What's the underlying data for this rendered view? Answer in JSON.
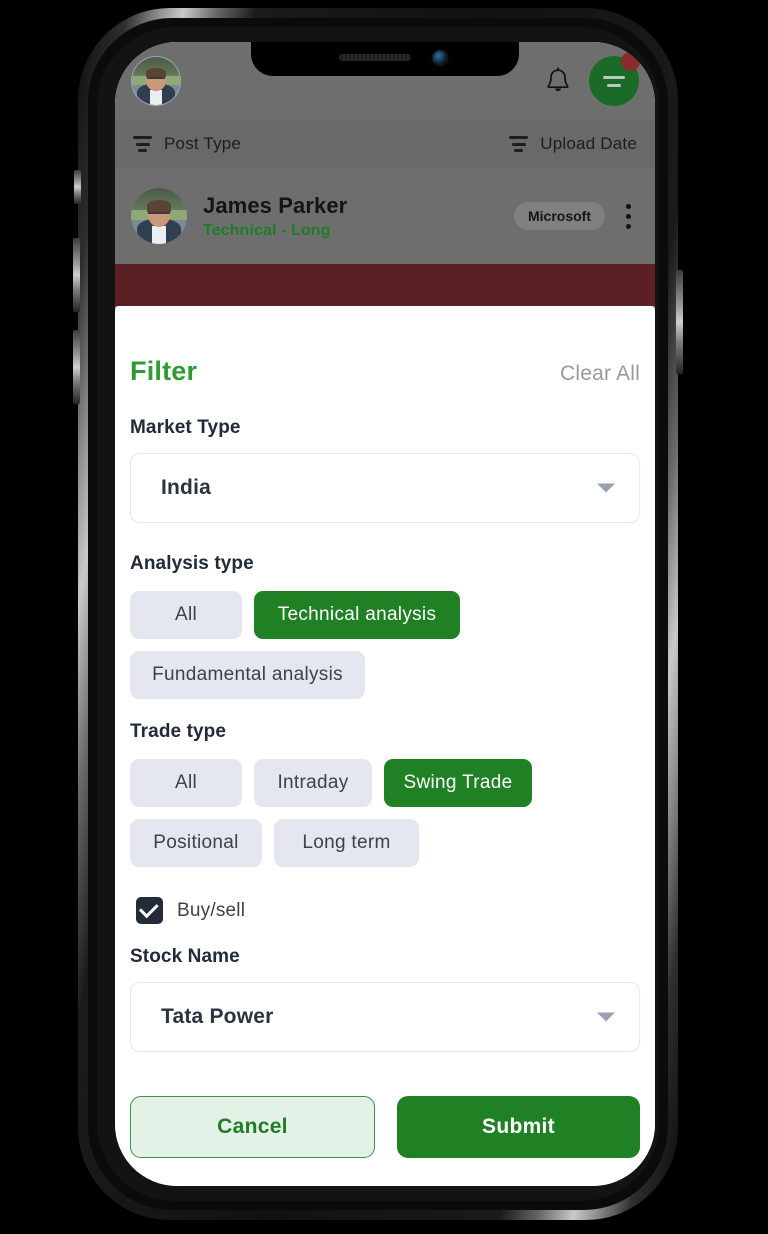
{
  "app": {
    "header": {
      "profile_avatar": "user-avatar",
      "bell_icon": "bell-icon",
      "menu_icon": "hamburger-menu-icon",
      "notification_badge": ""
    },
    "sort_bar": {
      "post_type_label": "Post Type",
      "upload_date_label": "Upload Date",
      "filter_icon": "filter-lines-icon"
    },
    "post": {
      "author": "James Parker",
      "subtitle": "Technical - Long",
      "tag": "Microsoft",
      "more_icon": "more-vertical-icon"
    }
  },
  "filter_sheet": {
    "title": "Filter",
    "clear_all": "Clear All",
    "market_type": {
      "label": "Market Type",
      "value": "India",
      "caret_icon": "chevron-down-icon"
    },
    "analysis_type": {
      "label": "Analysis type",
      "options": [
        {
          "label": "All",
          "selected": false
        },
        {
          "label": "Technical analysis",
          "selected": true
        },
        {
          "label": "Fundamental analysis",
          "selected": false
        }
      ]
    },
    "trade_type": {
      "label": "Trade type",
      "options": [
        {
          "label": "All",
          "selected": false
        },
        {
          "label": "Intraday",
          "selected": false
        },
        {
          "label": "Swing Trade",
          "selected": true
        },
        {
          "label": "Positional",
          "selected": false
        },
        {
          "label": "Long term",
          "selected": false
        }
      ]
    },
    "buy_sell": {
      "label": "Buy/sell",
      "checked": true
    },
    "stock_name": {
      "label": "Stock Name",
      "value": "Tata Power",
      "caret_icon": "chevron-down-icon"
    },
    "cancel_label": "Cancel",
    "submit_label": "Submit"
  },
  "colors": {
    "brand_green": "#1f8124",
    "title_green": "#2e9c31",
    "chip_idle_bg": "#e4e7ef",
    "dark_navy": "#232b3a",
    "red_band": "#5a2024",
    "scrim_grey": "#6e6e6e"
  }
}
